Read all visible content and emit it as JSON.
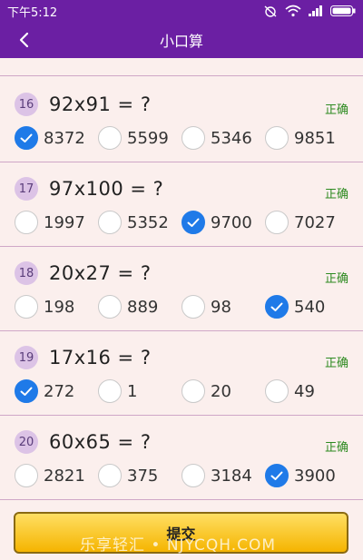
{
  "status_bar": {
    "time": "下午5:12"
  },
  "header": {
    "title": "小口算"
  },
  "questions": [
    {
      "num": "16",
      "text": "92x91 = ?",
      "status": "正确",
      "options": [
        "8372",
        "5599",
        "5346",
        "9851"
      ],
      "selected": 0
    },
    {
      "num": "17",
      "text": "97x100 = ?",
      "status": "正确",
      "options": [
        "1997",
        "5352",
        "9700",
        "7027"
      ],
      "selected": 2
    },
    {
      "num": "18",
      "text": "20x27 = ?",
      "status": "正确",
      "options": [
        "198",
        "889",
        "98",
        "540"
      ],
      "selected": 3
    },
    {
      "num": "19",
      "text": "17x16 = ?",
      "status": "正确",
      "options": [
        "272",
        "1",
        "20",
        "49"
      ],
      "selected": 0
    },
    {
      "num": "20",
      "text": "60x65 = ?",
      "status": "正确",
      "options": [
        "2821",
        "375",
        "3184",
        "3900"
      ],
      "selected": 3
    }
  ],
  "submit_label": "提交",
  "watermark": "乐享轻汇 • NJYCQH.COM",
  "colors": {
    "accent": "#6b1fa3",
    "check": "#1f7ae8",
    "correct": "#2d8a20",
    "button": "#f5b400"
  }
}
